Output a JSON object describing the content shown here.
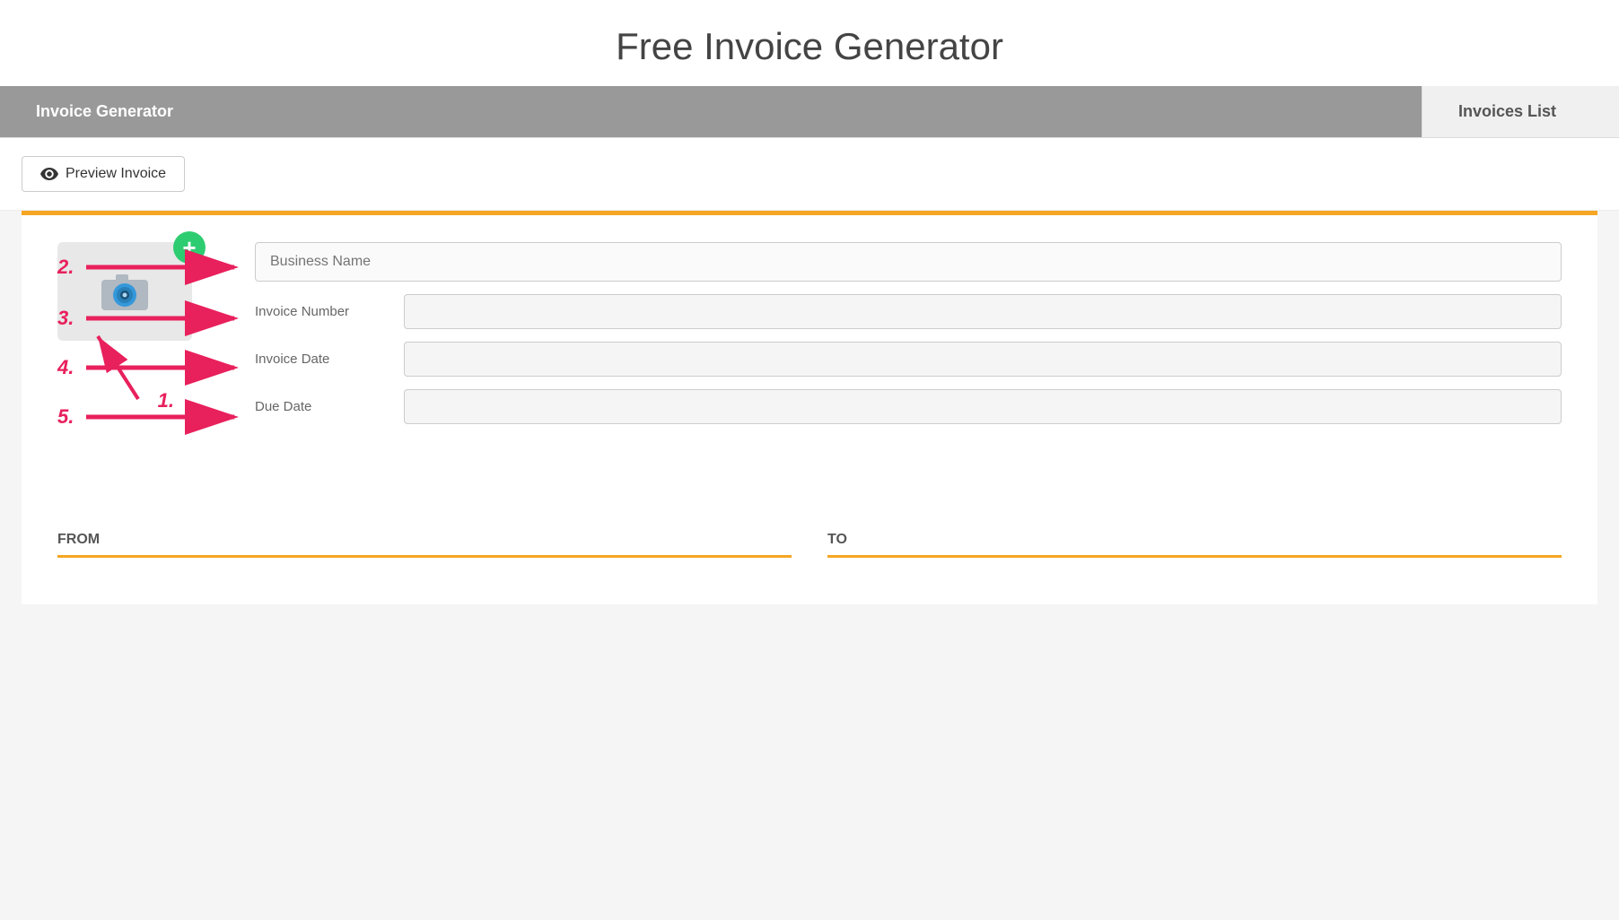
{
  "page": {
    "title": "Free Invoice Generator"
  },
  "tabs": {
    "active": "Invoice Generator",
    "inactive": "Invoices List"
  },
  "toolbar": {
    "preview_button": "Preview Invoice"
  },
  "form": {
    "business_name_placeholder": "Business Name",
    "invoice_number_label": "Invoice Number",
    "invoice_date_label": "Invoice Date",
    "due_date_label": "Due Date"
  },
  "sections": {
    "from_label": "FROM",
    "to_label": "TO"
  },
  "annotations": {
    "one": "1.",
    "two": "2.",
    "three": "3.",
    "four": "4.",
    "five": "5."
  },
  "icons": {
    "eye": "👁",
    "camera": "camera-icon",
    "add": "+"
  },
  "colors": {
    "orange": "#f5a623",
    "green": "#2ecc71",
    "pink_arrow": "#e8205c",
    "tab_active_bg": "#999999",
    "tab_inactive_bg": "#f0f0f0"
  }
}
